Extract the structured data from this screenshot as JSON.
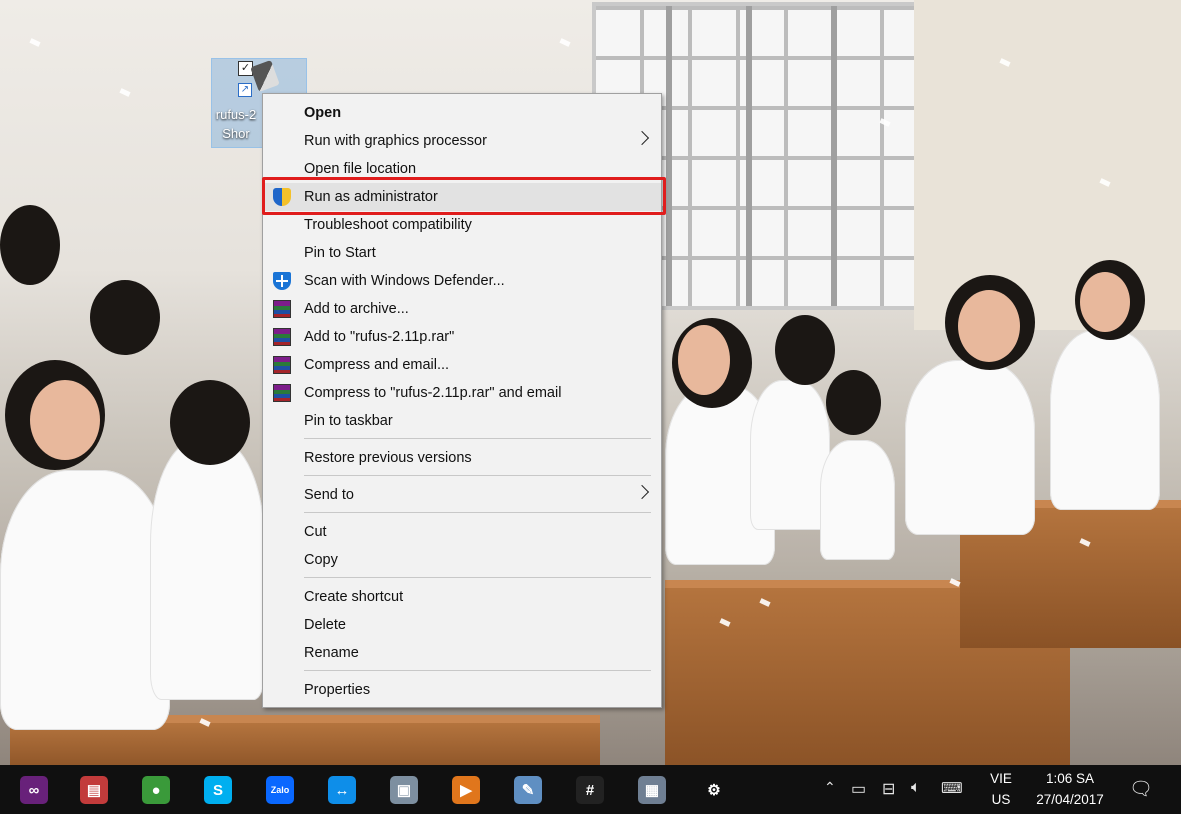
{
  "desktop": {
    "icon_label": "rufus-2.11p\nShortcut",
    "icon_label_visible": "rufus-2\nShor"
  },
  "context_menu": {
    "items": [
      {
        "label": "Open",
        "bold": true
      },
      {
        "label": "Run with graphics processor",
        "submenu": true
      },
      {
        "label": "Open file location"
      },
      {
        "label": "Run as administrator",
        "icon": "uac-shield-icon",
        "highlighted": true
      },
      {
        "label": "Troubleshoot compatibility"
      },
      {
        "label": "Pin to Start"
      },
      {
        "label": "Scan with Windows Defender...",
        "icon": "windows-defender-icon"
      },
      {
        "label": "Add to archive...",
        "icon": "winrar-icon"
      },
      {
        "label": "Add to \"rufus-2.11p.rar\"",
        "icon": "winrar-icon"
      },
      {
        "label": "Compress and email...",
        "icon": "winrar-icon"
      },
      {
        "label": "Compress to \"rufus-2.11p.rar\" and email",
        "icon": "winrar-icon"
      },
      {
        "label": "Pin to taskbar"
      },
      {
        "label": "Restore previous versions"
      },
      {
        "label": "Send to",
        "submenu": true
      },
      {
        "label": "Cut"
      },
      {
        "label": "Copy"
      },
      {
        "label": "Create shortcut"
      },
      {
        "label": "Delete"
      },
      {
        "label": "Rename"
      },
      {
        "label": "Properties"
      }
    ],
    "highlight_color": "#e01d1d"
  },
  "taskbar": {
    "apps": [
      {
        "name": "visual-studio-icon",
        "glyph": "∞",
        "color": "#68217a"
      },
      {
        "name": "winrar-taskbar-icon",
        "glyph": "▤",
        "color": "#c23b3b"
      },
      {
        "name": "internet-download-manager-icon",
        "glyph": "●",
        "color": "#3a9a3a"
      },
      {
        "name": "skype-icon",
        "glyph": "S",
        "color": "#00aff0"
      },
      {
        "name": "zalo-icon",
        "glyph": "Zalo",
        "color": "#0a68ff"
      },
      {
        "name": "teamviewer-icon",
        "glyph": "↔",
        "color": "#0e8ee9"
      },
      {
        "name": "monitor-app-icon",
        "glyph": "▣",
        "color": "#7d8fa0"
      },
      {
        "name": "media-player-icon",
        "glyph": "▶",
        "color": "#e0761c"
      },
      {
        "name": "notepad-icon",
        "glyph": "✎",
        "color": "#5f8fc2"
      },
      {
        "name": "slack-icon",
        "glyph": "#",
        "color": "#222222"
      },
      {
        "name": "calculator-icon",
        "glyph": "▦",
        "color": "#6f7f93"
      },
      {
        "name": "settings-gear-icon",
        "glyph": "⚙",
        "color": "#101010"
      }
    ],
    "language_top": "VIE",
    "language_bottom": "US",
    "time": "1:06 SA",
    "date": "27/04/2017"
  }
}
